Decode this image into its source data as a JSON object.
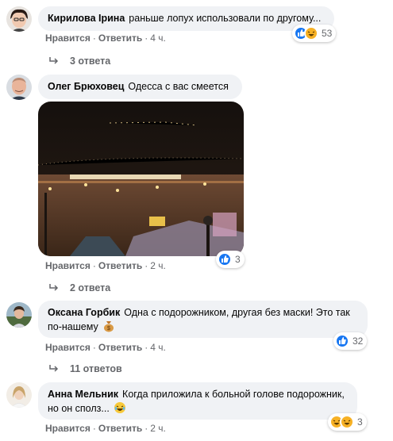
{
  "comments": [
    {
      "author": "Кирилова Ірина",
      "text": "раньше лопух использовали по другому...",
      "like": "Нравится",
      "reply": "Ответить",
      "time": "4 ч.",
      "reactions_count": "53",
      "replies": "3 ответа"
    },
    {
      "author": "Олег Брюховец",
      "text": "Одесса с вас смеется",
      "like": "Нравится",
      "reply": "Ответить",
      "time": "2 ч.",
      "reactions_count": "3",
      "replies": "2 ответа"
    },
    {
      "author": "Оксана Горбик",
      "text_line1": "Одна с подорожником, другая без маски! Это так",
      "text_line2": "по-нашему",
      "like": "Нравится",
      "reply": "Ответить",
      "time": "4 ч.",
      "reactions_count": "32",
      "replies": "11 ответов"
    },
    {
      "author": "Анна Мельник",
      "text_line1": "Когда приложила к больной голове подорожник,",
      "text_line2": "но он сполз...",
      "like": "Нравится",
      "reply": "Ответить",
      "time": "2 ч.",
      "reactions_count": "3"
    }
  ],
  "colors": {
    "bubble": "#f0f2f5",
    "secondary_text": "#65676b",
    "like_blue": "#1877f2",
    "haha_yellow": "#f7b125"
  },
  "icons": [
    "like-reaction-icon",
    "haha-reaction-icon",
    "reply-arrow-icon",
    "money-bag-emoji-icon",
    "laughing-emoji-icon"
  ]
}
